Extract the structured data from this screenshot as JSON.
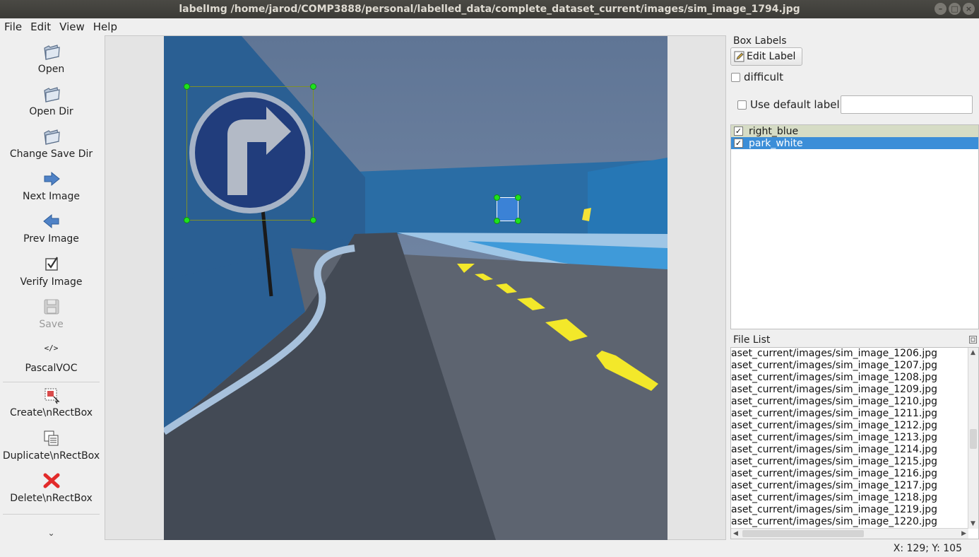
{
  "window": {
    "title": "labelImg /home/jarod/COMP3888/personal/labelled_data/complete_dataset_current/images/sim_image_1794.jpg",
    "controls": [
      "–",
      "□",
      "×"
    ]
  },
  "menu": {
    "file": "File",
    "edit": "Edit",
    "view": "View",
    "help": "Help"
  },
  "toolbar": {
    "open": "Open",
    "open_dir": "Open Dir",
    "change_save_dir": "Change Save Dir",
    "next_image": "Next Image",
    "prev_image": "Prev Image",
    "verify_image": "Verify Image",
    "save": "Save",
    "format_icon": "</>",
    "format": "PascalVOC",
    "create_rect": "Create\\nRectBox",
    "duplicate_rect": "Duplicate\\nRectBox",
    "delete_rect": "Delete\\nRectBox",
    "more": "⌄"
  },
  "box_labels": {
    "title": "Box Labels",
    "edit_label_button": "Edit Label",
    "difficult": "difficult",
    "use_default_label": "Use default label",
    "default_label_value": "",
    "labels": [
      {
        "name": "right_blue",
        "checked": true,
        "selected": false
      },
      {
        "name": "park_white",
        "checked": true,
        "selected": true
      }
    ]
  },
  "file_list": {
    "title": "File List",
    "files": [
      "aset_current/images/sim_image_1206.jpg",
      "aset_current/images/sim_image_1207.jpg",
      "aset_current/images/sim_image_1208.jpg",
      "aset_current/images/sim_image_1209.jpg",
      "aset_current/images/sim_image_1210.jpg",
      "aset_current/images/sim_image_1211.jpg",
      "aset_current/images/sim_image_1212.jpg",
      "aset_current/images/sim_image_1213.jpg",
      "aset_current/images/sim_image_1214.jpg",
      "aset_current/images/sim_image_1215.jpg",
      "aset_current/images/sim_image_1216.jpg",
      "aset_current/images/sim_image_1217.jpg",
      "aset_current/images/sim_image_1218.jpg",
      "aset_current/images/sim_image_1219.jpg",
      "aset_current/images/sim_image_1220.jpg"
    ]
  },
  "status": {
    "coordinates": "X: 129; Y: 105"
  },
  "colors": {
    "selection": "#3b8ed8",
    "bbox_handle": "#1ee21e",
    "titlebar": "#3c3b37"
  }
}
